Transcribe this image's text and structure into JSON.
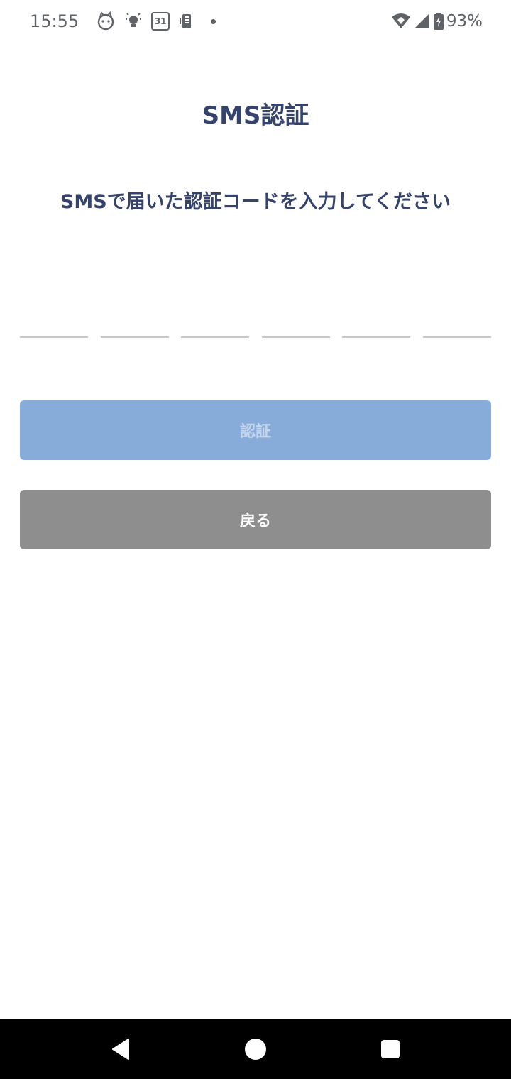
{
  "status_bar": {
    "time": "15:55",
    "calendar_day": "31",
    "battery_percent": "93%",
    "icons": [
      "cat-icon",
      "bulb-icon",
      "calendar-icon",
      "phone-icon",
      "dot-icon",
      "wifi-icon",
      "signal-icon",
      "battery-icon"
    ]
  },
  "page": {
    "title": "SMS認証",
    "instruction": "SMSで届いた認証コードを入力してください"
  },
  "code_input": {
    "digits": [
      "",
      "",
      "",
      "",
      "",
      ""
    ]
  },
  "buttons": {
    "verify_label": "認証",
    "back_label": "戻る"
  },
  "colors": {
    "title_text": "#36436a",
    "verify_button_disabled": "#88acda",
    "back_button": "#8e8e8e",
    "underline": "#c8c8c8",
    "nav_bar": "#000000"
  },
  "nav_bar": {
    "icons": [
      "back-triangle-icon",
      "home-circle-icon",
      "recents-square-icon"
    ]
  }
}
